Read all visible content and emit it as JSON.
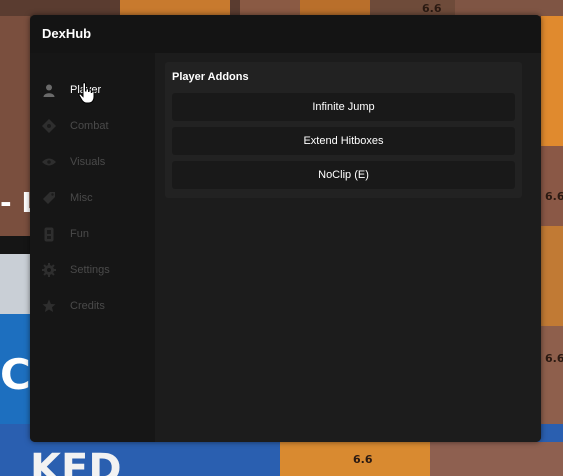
{
  "window": {
    "title": "DexHub"
  },
  "sidebar": {
    "items": [
      {
        "label": "Player",
        "icon": "person-icon",
        "active": true
      },
      {
        "label": "Combat",
        "icon": "target-icon",
        "active": false
      },
      {
        "label": "Visuals",
        "icon": "eye-icon",
        "active": false
      },
      {
        "label": "Misc",
        "icon": "tag-icon",
        "active": false
      },
      {
        "label": "Fun",
        "icon": "gamepad-icon",
        "active": false
      },
      {
        "label": "Settings",
        "icon": "gear-icon",
        "active": false
      },
      {
        "label": "Credits",
        "icon": "star-icon",
        "active": false
      }
    ]
  },
  "main": {
    "section_title": "Player Addons",
    "buttons": [
      {
        "label": "Infinite Jump"
      },
      {
        "label": "Extend Hitboxes"
      },
      {
        "label": "NoClip (E)"
      }
    ]
  },
  "background": {
    "text_left_top": "- L",
    "text_left_mid": "C",
    "text_bottom": "KED",
    "crate_labels": [
      "6.6",
      "6.6",
      "6.6",
      "6.6"
    ]
  },
  "colors": {
    "window_bg": "#1c1c1c",
    "sidebar_bg": "#161616",
    "button_bg": "#191919",
    "active_text": "#ffffff",
    "inactive_text": "#4a4a4a"
  }
}
